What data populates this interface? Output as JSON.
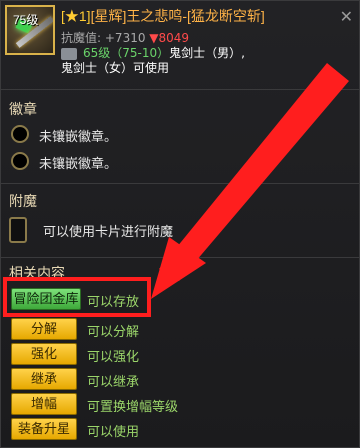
{
  "header": {
    "level_badge": "75级",
    "title_prefix": "[★1]",
    "title_main": "[星辉]王之悲鸣-[猛龙断空斩]",
    "resist_label": "抗魔值:",
    "resist_up": "+7310",
    "resist_down": "▼8049",
    "level_range": "65级（75-10）",
    "class_male": "鬼剑士（男）,",
    "class_female": "鬼剑士（女）可使用",
    "close_icon": "close-icon"
  },
  "emblem": {
    "title": "徽章",
    "slots": [
      "未镶嵌徽章。",
      "未镶嵌徽章。"
    ]
  },
  "enchant": {
    "title": "附魔",
    "text": "可以使用卡片进行附魔"
  },
  "related": {
    "title": "相关内容",
    "items": [
      {
        "button": "冒险团金库",
        "desc": "可以存放"
      },
      {
        "button": "分解",
        "desc": "可以分解"
      },
      {
        "button": "强化",
        "desc": "可以强化"
      },
      {
        "button": "继承",
        "desc": "可以继承"
      },
      {
        "button": "增幅",
        "desc": "可置换增幅等级"
      },
      {
        "button": "装备升星",
        "desc": "可以使用"
      }
    ]
  },
  "colors": {
    "highlight": "#ff1e1e",
    "button_yellow": "#ffd24a",
    "button_green": "#7de07a",
    "desc_green": "#9bd66a",
    "title_orange": "#ffb347"
  }
}
